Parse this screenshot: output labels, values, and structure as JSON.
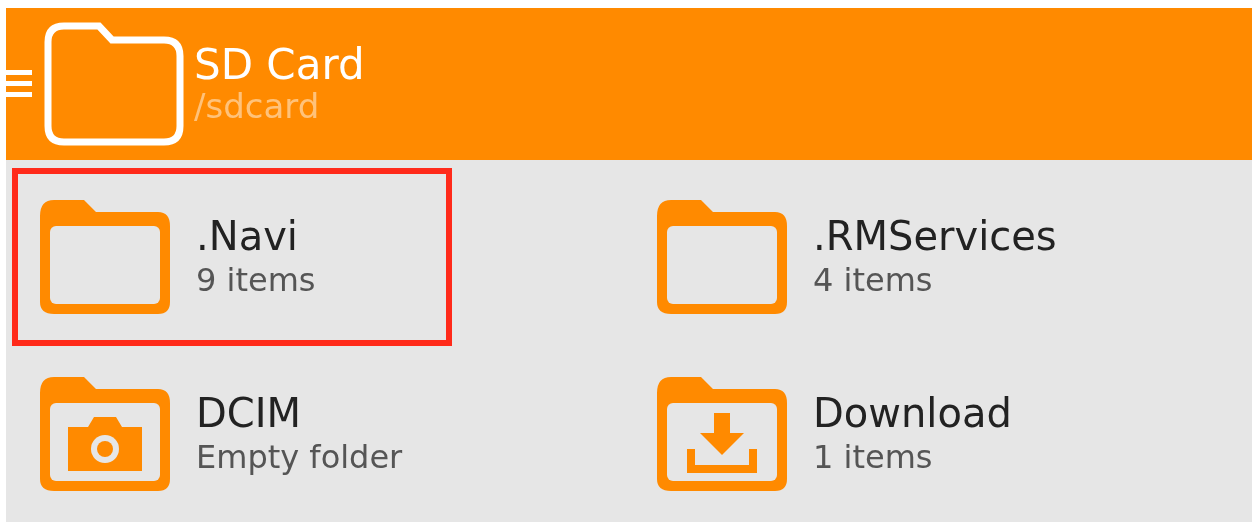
{
  "header": {
    "title": "SD Card",
    "path": "/sdcard"
  },
  "items": [
    {
      "name": ".Navi",
      "count": "9 items",
      "kind": "folder",
      "highlighted": true
    },
    {
      "name": ".RMServices",
      "count": "4 items",
      "kind": "folder",
      "highlighted": false
    },
    {
      "name": "DCIM",
      "count": "Empty folder",
      "kind": "camera",
      "highlighted": false
    },
    {
      "name": "Download",
      "count": "1 items",
      "kind": "download",
      "highlighted": false
    }
  ]
}
